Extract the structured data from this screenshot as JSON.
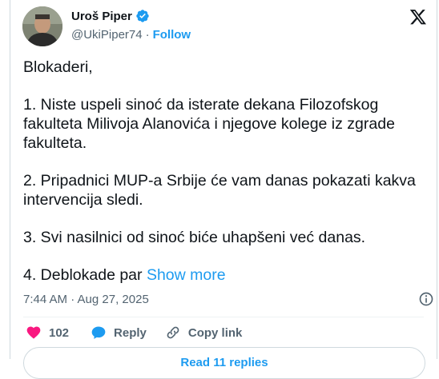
{
  "author": {
    "display_name": "Uroš Piper",
    "handle": "@UkiPiper74",
    "separator": "·",
    "follow_label": "Follow"
  },
  "tweet": {
    "paragraphs": [
      "Blokaderi,",
      "1. Niste uspeli sinoć da isterate dekana Filozofskog",
      "fakulteta Milivoja Alanovića i njegove kolege iz zgrade",
      "fakulteta.",
      "2. Pripadnici MUP-a Srbije će vam danas pokazati kakva",
      "intervencija sledi.",
      "3. Svi nasilnici od sinoć biće uhapšeni već danas.",
      "4. Deblokade par "
    ],
    "show_more_label": "Show more",
    "timestamp": "7:44 AM · Aug 27, 2025"
  },
  "actions": {
    "like_count": "102",
    "reply_label": "Reply",
    "copy_link_label": "Copy link"
  },
  "footer": {
    "read_replies_label": "Read 11 replies"
  },
  "colors": {
    "accent": "#1d9bf0",
    "like": "#f91880",
    "muted": "#536471",
    "text": "#0f1419"
  },
  "icons": {
    "verified": "verified-badge-icon",
    "brand": "x-logo-icon",
    "info": "info-icon",
    "like": "heart-icon",
    "reply": "reply-bubble-icon",
    "copy": "link-icon"
  }
}
